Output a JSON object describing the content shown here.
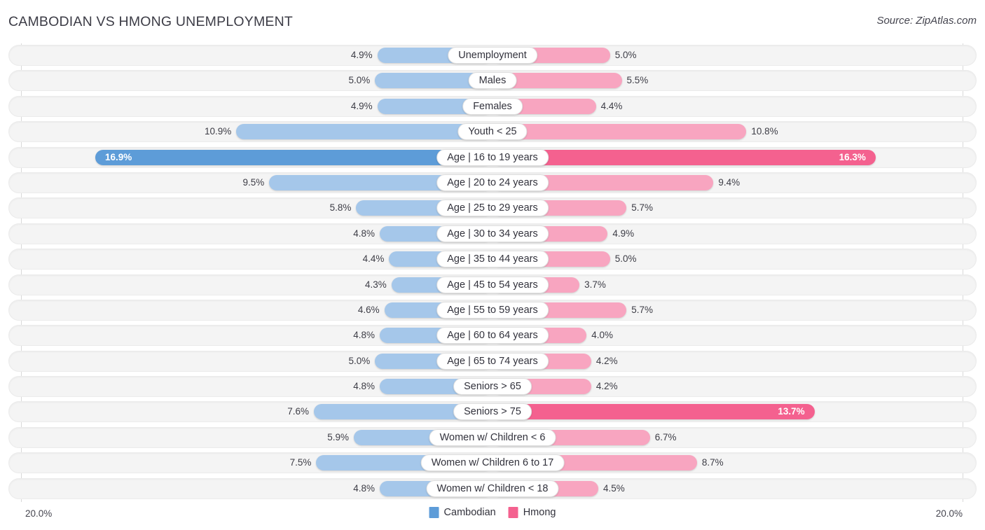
{
  "header": {
    "title": "CAMBODIAN VS HMONG UNEMPLOYMENT",
    "source": "Source: ZipAtlas.com"
  },
  "footer": {
    "axis_min_label": "20.0%",
    "axis_max_label": "20.0%",
    "legend": [
      {
        "label": "Cambodian",
        "color": "#5d9cd8"
      },
      {
        "label": "Hmong",
        "color": "#f4618f"
      }
    ]
  },
  "colors": {
    "blue_light": "#a5c7ea",
    "blue_dark": "#5d9cd8",
    "pink_light": "#f8a5c0",
    "pink_dark": "#f4618f",
    "track": "#f4f4f4",
    "title": "#3c3c46"
  },
  "chart_data": {
    "type": "bar",
    "subtype": "diverging-bidirectional",
    "title": "CAMBODIAN VS HMONG UNEMPLOYMENT",
    "xlabel": "",
    "ylabel": "",
    "xlim": [
      20.0,
      20.0
    ],
    "axis_max": 20.0,
    "grid": false,
    "legend_position": "bottom-center",
    "categories": [
      "Unemployment",
      "Males",
      "Females",
      "Youth < 25",
      "Age | 16 to 19 years",
      "Age | 20 to 24 years",
      "Age | 25 to 29 years",
      "Age | 30 to 34 years",
      "Age | 35 to 44 years",
      "Age | 45 to 54 years",
      "Age | 55 to 59 years",
      "Age | 60 to 64 years",
      "Age | 65 to 74 years",
      "Seniors > 65",
      "Seniors > 75",
      "Women w/ Children < 6",
      "Women w/ Children 6 to 17",
      "Women w/ Children < 18"
    ],
    "series": [
      {
        "name": "Cambodian",
        "color": "#a5c7ea",
        "values": [
          4.9,
          5.0,
          4.9,
          10.9,
          16.9,
          9.5,
          5.8,
          4.8,
          4.4,
          4.3,
          4.6,
          4.8,
          5.0,
          4.8,
          7.6,
          5.9,
          7.5,
          4.8
        ],
        "labels": [
          "4.9%",
          "5.0%",
          "4.9%",
          "10.9%",
          "16.9%",
          "9.5%",
          "5.8%",
          "4.8%",
          "4.4%",
          "4.3%",
          "4.6%",
          "4.8%",
          "5.0%",
          "4.8%",
          "7.6%",
          "5.9%",
          "7.5%",
          "4.8%"
        ]
      },
      {
        "name": "Hmong",
        "color": "#f8a5c0",
        "values": [
          5.0,
          5.5,
          4.4,
          10.8,
          16.3,
          9.4,
          5.7,
          4.9,
          5.0,
          3.7,
          5.7,
          4.0,
          4.2,
          4.2,
          13.7,
          6.7,
          8.7,
          4.5
        ],
        "labels": [
          "5.0%",
          "5.5%",
          "4.4%",
          "10.8%",
          "16.3%",
          "9.4%",
          "5.7%",
          "4.9%",
          "5.0%",
          "3.7%",
          "5.7%",
          "4.0%",
          "4.2%",
          "4.2%",
          "13.7%",
          "6.7%",
          "8.7%",
          "4.5%"
        ]
      }
    ]
  },
  "rows": [
    {
      "label": "Unemployment",
      "left": {
        "value": 4.9,
        "text": "4.9%",
        "highlight": false
      },
      "right": {
        "value": 5.0,
        "text": "5.0%",
        "highlight": false
      }
    },
    {
      "label": "Males",
      "left": {
        "value": 5.0,
        "text": "5.0%",
        "highlight": false
      },
      "right": {
        "value": 5.5,
        "text": "5.5%",
        "highlight": false
      }
    },
    {
      "label": "Females",
      "left": {
        "value": 4.9,
        "text": "4.9%",
        "highlight": false
      },
      "right": {
        "value": 4.4,
        "text": "4.4%",
        "highlight": false
      }
    },
    {
      "label": "Youth < 25",
      "left": {
        "value": 10.9,
        "text": "10.9%",
        "highlight": false
      },
      "right": {
        "value": 10.8,
        "text": "10.8%",
        "highlight": false
      }
    },
    {
      "label": "Age | 16 to 19 years",
      "left": {
        "value": 16.9,
        "text": "16.9%",
        "highlight": true
      },
      "right": {
        "value": 16.3,
        "text": "16.3%",
        "highlight": true
      }
    },
    {
      "label": "Age | 20 to 24 years",
      "left": {
        "value": 9.5,
        "text": "9.5%",
        "highlight": false
      },
      "right": {
        "value": 9.4,
        "text": "9.4%",
        "highlight": false
      }
    },
    {
      "label": "Age | 25 to 29 years",
      "left": {
        "value": 5.8,
        "text": "5.8%",
        "highlight": false
      },
      "right": {
        "value": 5.7,
        "text": "5.7%",
        "highlight": false
      }
    },
    {
      "label": "Age | 30 to 34 years",
      "left": {
        "value": 4.8,
        "text": "4.8%",
        "highlight": false
      },
      "right": {
        "value": 4.9,
        "text": "4.9%",
        "highlight": false
      }
    },
    {
      "label": "Age | 35 to 44 years",
      "left": {
        "value": 4.4,
        "text": "4.4%",
        "highlight": false
      },
      "right": {
        "value": 5.0,
        "text": "5.0%",
        "highlight": false
      }
    },
    {
      "label": "Age | 45 to 54 years",
      "left": {
        "value": 4.3,
        "text": "4.3%",
        "highlight": false
      },
      "right": {
        "value": 3.7,
        "text": "3.7%",
        "highlight": false
      }
    },
    {
      "label": "Age | 55 to 59 years",
      "left": {
        "value": 4.6,
        "text": "4.6%",
        "highlight": false
      },
      "right": {
        "value": 5.7,
        "text": "5.7%",
        "highlight": false
      }
    },
    {
      "label": "Age | 60 to 64 years",
      "left": {
        "value": 4.8,
        "text": "4.8%",
        "highlight": false
      },
      "right": {
        "value": 4.0,
        "text": "4.0%",
        "highlight": false
      }
    },
    {
      "label": "Age | 65 to 74 years",
      "left": {
        "value": 5.0,
        "text": "5.0%",
        "highlight": false
      },
      "right": {
        "value": 4.2,
        "text": "4.2%",
        "highlight": false
      }
    },
    {
      "label": "Seniors > 65",
      "left": {
        "value": 4.8,
        "text": "4.8%",
        "highlight": false
      },
      "right": {
        "value": 4.2,
        "text": "4.2%",
        "highlight": false
      }
    },
    {
      "label": "Seniors > 75",
      "left": {
        "value": 7.6,
        "text": "7.6%",
        "highlight": false
      },
      "right": {
        "value": 13.7,
        "text": "13.7%",
        "highlight": true
      }
    },
    {
      "label": "Women w/ Children < 6",
      "left": {
        "value": 5.9,
        "text": "5.9%",
        "highlight": false
      },
      "right": {
        "value": 6.7,
        "text": "6.7%",
        "highlight": false
      }
    },
    {
      "label": "Women w/ Children 6 to 17",
      "left": {
        "value": 7.5,
        "text": "7.5%",
        "highlight": false
      },
      "right": {
        "value": 8.7,
        "text": "8.7%",
        "highlight": false
      }
    },
    {
      "label": "Women w/ Children < 18",
      "left": {
        "value": 4.8,
        "text": "4.8%",
        "highlight": false
      },
      "right": {
        "value": 4.5,
        "text": "4.5%",
        "highlight": false
      }
    }
  ]
}
